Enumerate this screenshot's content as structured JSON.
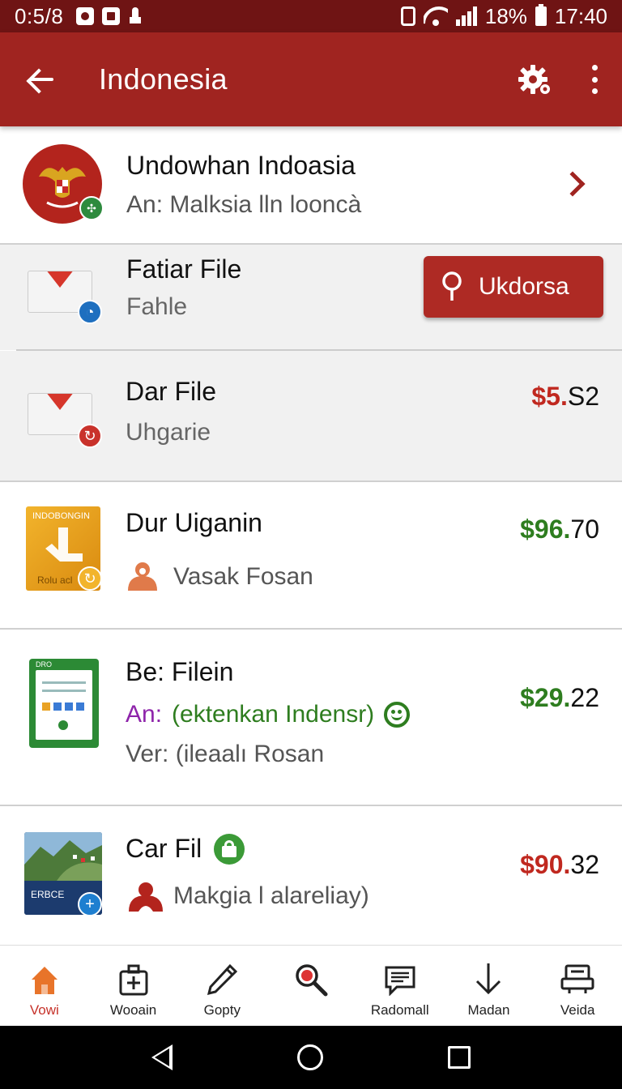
{
  "status_bar": {
    "time_left": "0:5/8",
    "battery": "18%",
    "time_right": "17:40"
  },
  "app_bar": {
    "title": "Indonesia",
    "back_icon": "arrow-back-icon",
    "settings_icon": "gear-icon",
    "more_icon": "more-vert-icon"
  },
  "header_card": {
    "title": "Undowhan Indoasia",
    "subtitle": "An: Malksia lln looncà"
  },
  "rows": [
    {
      "title": "Fatiar File",
      "subtitle": "Fahle",
      "button_label": "Ukdorsa"
    },
    {
      "title": "Dar File",
      "subtitle": "Uhgarie",
      "price_main": "$5.",
      "price_cents": "S2",
      "price_color": "#c0281f"
    },
    {
      "title": "Dur Uiganin",
      "subtitle": "Vasak Fosan",
      "price_main": "$96.",
      "price_cents": "70",
      "price_color": "#2e7d1f",
      "thumb_text_top": "INDOBONGIN",
      "thumb_text_bottom": "Rolu acl"
    },
    {
      "title": "Be: Filein",
      "sub_prefix": "An:",
      "sub_highlight": "(ektenkan Indensr)",
      "sub_line2": "Ver: (ileaalı Rosan",
      "price_main": "$29.",
      "price_cents": "22",
      "price_color": "#2e7d1f",
      "thumb_text": "DRO"
    },
    {
      "title": "Car Fil",
      "subtitle": "Makgia l alareliay)",
      "price_main": "$90.",
      "price_cents": "32",
      "price_color": "#c0281f",
      "thumb_text": "ERBCE"
    }
  ],
  "bottom_nav": [
    {
      "label": "Vowi",
      "icon": "home-icon",
      "active": true
    },
    {
      "label": "Wooain",
      "icon": "medical-bag-icon",
      "active": false
    },
    {
      "label": "Gopty",
      "icon": "pen-icon",
      "active": false
    },
    {
      "label": "",
      "icon": "search-icon",
      "active": false
    },
    {
      "label": "Radomall",
      "icon": "message-icon",
      "active": false
    },
    {
      "label": "Madan",
      "icon": "download-arrow-icon",
      "active": false
    },
    {
      "label": "Veida",
      "icon": "printer-icon",
      "active": false
    }
  ],
  "colors": {
    "primary": "#a02420",
    "status_bar": "#6f1414",
    "green": "#2e7d1f",
    "red_price": "#c0281f",
    "purple": "#8e24aa"
  }
}
